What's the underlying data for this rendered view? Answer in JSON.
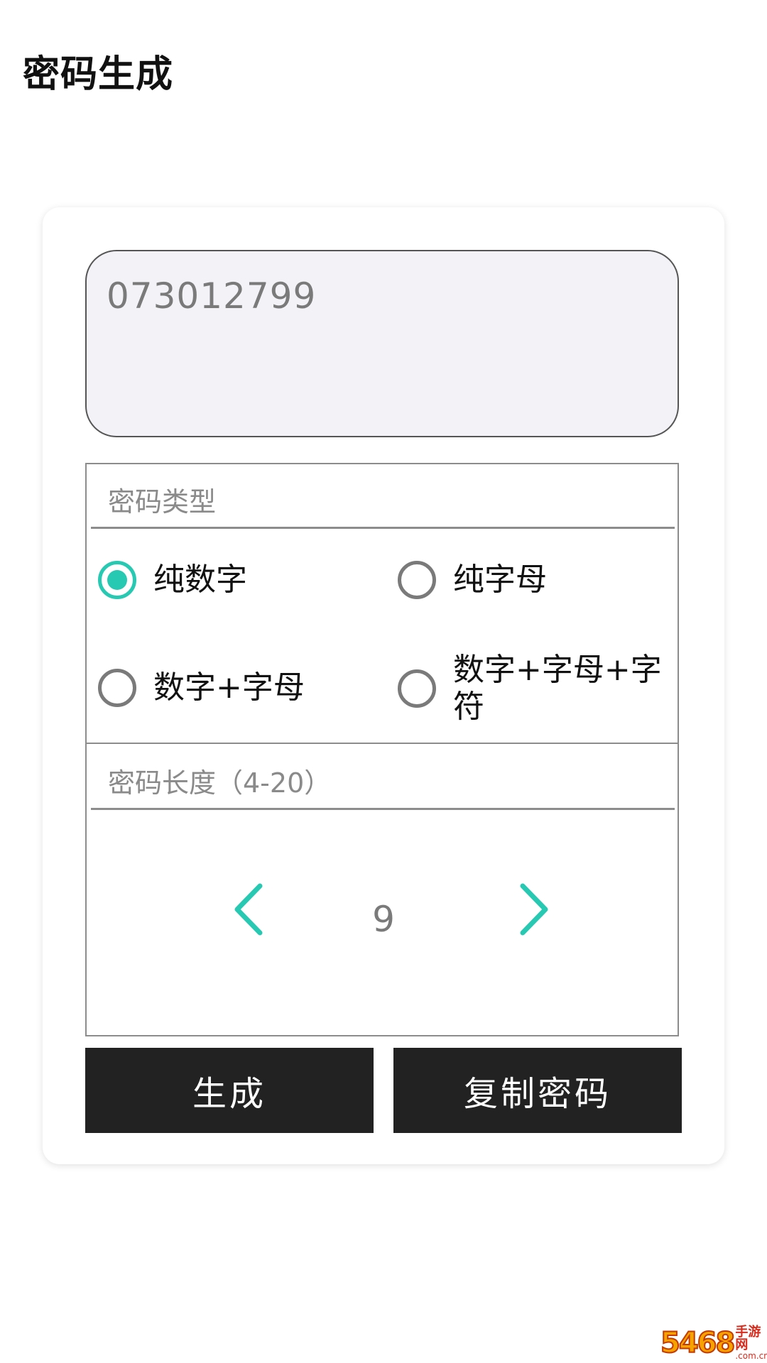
{
  "header": {
    "title": "密码生成"
  },
  "output": {
    "value": "073012799"
  },
  "password_type": {
    "label": "密码类型",
    "options": [
      {
        "label": "纯数字",
        "selected": true
      },
      {
        "label": "纯字母",
        "selected": false
      },
      {
        "label": "数字+字母",
        "selected": false
      },
      {
        "label": "数字+字母+字符",
        "selected": false
      }
    ]
  },
  "password_length": {
    "label": "密码长度（4-20）",
    "value": "9",
    "min": 4,
    "max": 20
  },
  "actions": {
    "generate_label": "生成",
    "copy_label": "复制密码"
  },
  "watermark": {
    "digits": "5468",
    "text": "手游网",
    "domain": ".com.cn"
  },
  "colors": {
    "accent": "#28c9b2",
    "button_bg": "#222222",
    "output_bg": "#f2f2f7"
  }
}
